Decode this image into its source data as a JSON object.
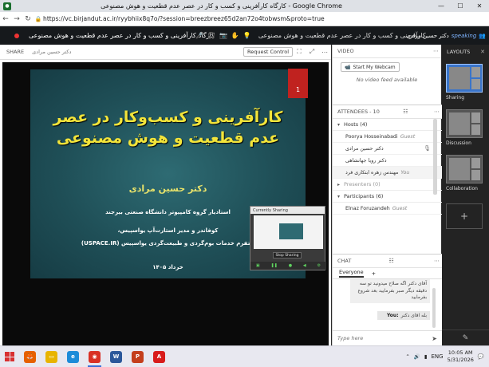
{
  "window": {
    "title": "کارگاه کارآفرینی و کسب و کار در عصر عدم قطعیت و هوش مصنوعی - Google Chrome",
    "favicon": "bbb-favicon"
  },
  "address": {
    "url": "https://vc.birjandut.ac.ir/ryybhiix8q7o/?session=breezbreez65d2an72o4tobwsm&proto=true"
  },
  "conference": {
    "room_name": "کارگاه کارآفرینی و کسب و کار در عصر عدم قطعیت و هوش مصنوعی",
    "center_text": "کارآفرینی و کسب و کار در عصر عدم قطعیت و هوش مصنوعی",
    "speaking_label": "speaking",
    "speaking_name": "دکتر حسین مرادی"
  },
  "share": {
    "header": "SHARE",
    "presenter": "دکتر حسین مرادی",
    "request_control": "Request Control"
  },
  "slide": {
    "page_number": "1",
    "title_line1": "کارآفرینی و کسب‌وکار در عصر",
    "title_line2": "عدم قطعیت و هوش مصنوعی",
    "author": "دکتر حسین مرادی",
    "affiliation1": "استادیار گروه کامپیوتر دانشگاه صنعتی بیرجند",
    "affiliation2": "کوفاندر و مدیر استارت‌آپ یواسپیس،",
    "affiliation3": "پلتفرم خدمات بوم‌گردی و طبیعت‌گردی یواسپیس (USPACE.IR)",
    "date": "خرداد ۱۴۰۵"
  },
  "mini_window": {
    "title": "Currently Sharing",
    "stop_button": "Stop Sharing"
  },
  "video": {
    "header": "VIDEO",
    "start_webcam": "Start My Webcam",
    "no_feed": "No video feed available"
  },
  "attendees": {
    "header": "ATTENDEES - 10",
    "hosts_label": "Hosts (4)",
    "hosts": [
      {
        "name": "Poorya Hosseinabadi",
        "role": "Guest"
      },
      {
        "name": "دکتر حسین مرادی",
        "role": ""
      },
      {
        "name": "دکتر رویا جهانشاهی",
        "role": ""
      },
      {
        "name": "مهندس زهره ابتکاری فرد",
        "role": "You"
      }
    ],
    "presenters_label": "Presenters (0)",
    "participants_label": "Participants (6)",
    "participants": [
      {
        "name": "Elnaz Foruzandeh",
        "role": "Guest"
      }
    ]
  },
  "chat": {
    "header": "CHAT",
    "tab_everyone": "Everyone",
    "tab_add": "+",
    "message1": "آقای دکتر اگه صلاح میدونید تو سه دقیقه دیگر صبر بفرمایید بعد شروع بفرمایید",
    "message2_sender": "You:",
    "message2_text": "بله اقای دکتر",
    "input_placeholder": "Type here"
  },
  "layouts": {
    "header": "LAYOUTS",
    "items": [
      {
        "label": "Sharing",
        "selected": true
      },
      {
        "label": "Discussion",
        "selected": false
      },
      {
        "label": "Collaboration",
        "selected": false
      }
    ]
  },
  "taskbar": {
    "apps": [
      {
        "name": "firefox-icon",
        "color": "#e66000",
        "glyph": "🦊"
      },
      {
        "name": "file-explorer-icon",
        "color": "#e8b400",
        "glyph": "▭"
      },
      {
        "name": "edge-icon",
        "color": "#1c8bd8",
        "glyph": "e"
      },
      {
        "name": "chrome-icon",
        "color": "#d93025",
        "glyph": "◉"
      },
      {
        "name": "word-icon",
        "color": "#2b579a",
        "glyph": "W"
      },
      {
        "name": "powerpoint-icon",
        "color": "#c43e1c",
        "glyph": "P"
      },
      {
        "name": "acrobat-icon",
        "color": "#d81b1b",
        "glyph": "A"
      }
    ],
    "time": "10:05 AM",
    "date": "5/31/2026",
    "lang": "ENG"
  },
  "colors": {
    "accent": "#3a74c9",
    "slide_title": "#f2e43a",
    "slide_background": "#1f4f57",
    "record": "#e33333"
  }
}
